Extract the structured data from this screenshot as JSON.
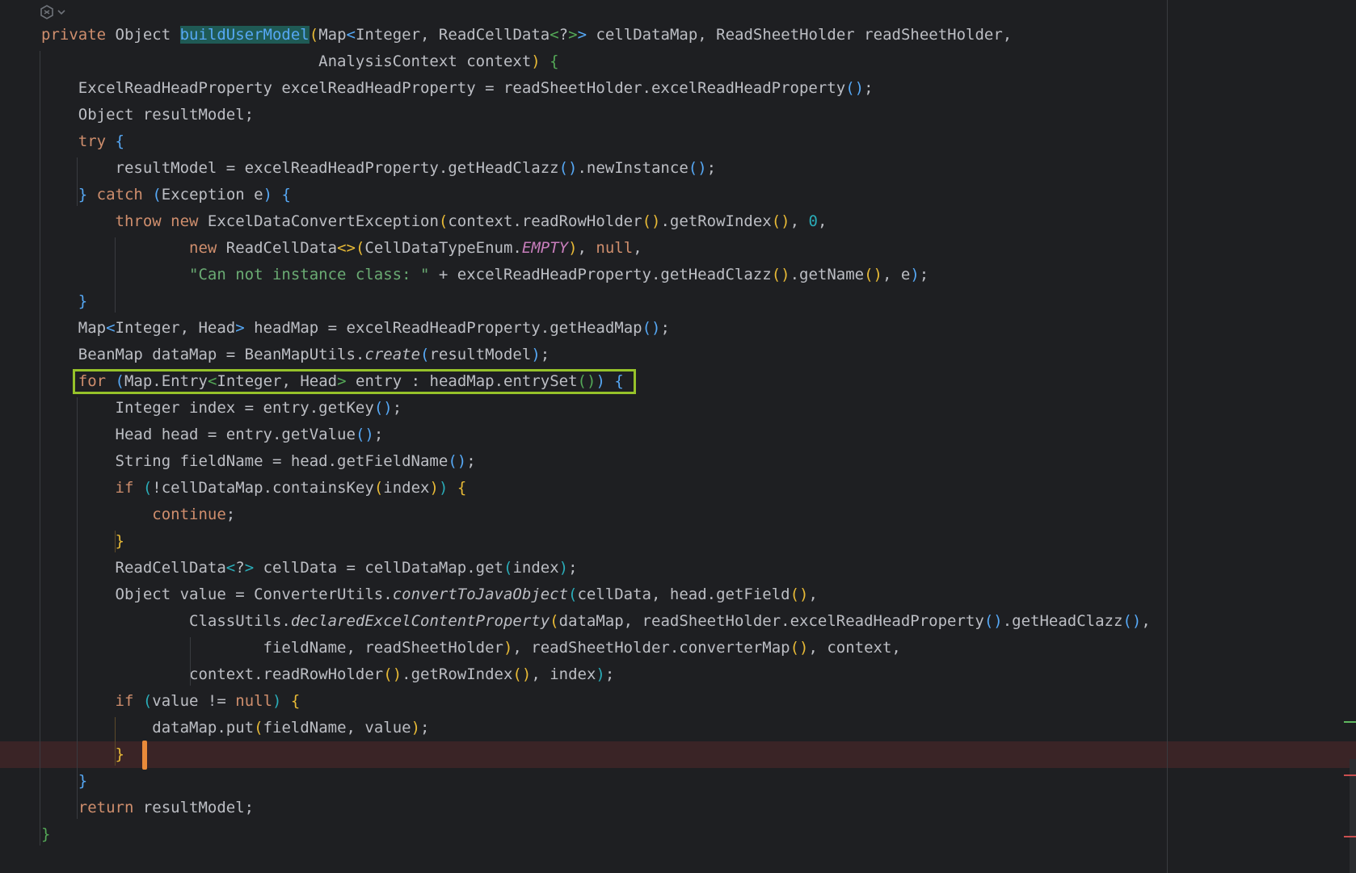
{
  "gutter": {
    "icon": "ai-assistant-icon",
    "chevron": "chevron-down-icon"
  },
  "highlights": {
    "green_box_line": 13,
    "orange_box_line": 27,
    "breakpoint_line": 27
  },
  "code_lines": [
    [
      [
        "kw",
        "private"
      ],
      [
        "p",
        " Object "
      ],
      [
        "hl",
        "buildUserModel"
      ],
      [
        "pn1",
        "("
      ],
      [
        "p",
        "Map"
      ],
      [
        "pn2",
        "<"
      ],
      [
        "p",
        "Integer, ReadCellData"
      ],
      [
        "pn3",
        "<"
      ],
      [
        "p",
        "?"
      ],
      [
        "pn3",
        ">"
      ],
      [
        "pn2",
        ">"
      ],
      [
        "p",
        " cellDataMap, ReadSheetHolder readSheetHolder,"
      ]
    ],
    [
      [
        "p",
        "                              AnalysisContext context"
      ],
      [
        "pn1",
        ")"
      ],
      [
        "p",
        " "
      ],
      [
        "pn3",
        "{"
      ]
    ],
    [
      [
        "p",
        "    ExcelReadHeadProperty excelReadHeadProperty = readSheetHolder.excelReadHeadProperty"
      ],
      [
        "pn2",
        "()"
      ],
      [
        "p",
        ";"
      ]
    ],
    [
      [
        "p",
        "    Object resultModel;"
      ]
    ],
    [
      [
        "kw",
        "    try"
      ],
      [
        "p",
        " "
      ],
      [
        "pn2",
        "{"
      ]
    ],
    [
      [
        "p",
        "        resultModel = excelReadHeadProperty.getHeadClazz"
      ],
      [
        "pn2",
        "()"
      ],
      [
        "p",
        ".newInstance"
      ],
      [
        "pn2",
        "()"
      ],
      [
        "p",
        ";"
      ]
    ],
    [
      [
        "pn2",
        "    }"
      ],
      [
        "p",
        " "
      ],
      [
        "kw",
        "catch"
      ],
      [
        "p",
        " "
      ],
      [
        "pn2",
        "("
      ],
      [
        "p",
        "Exception e"
      ],
      [
        "pn2",
        ")"
      ],
      [
        "p",
        " "
      ],
      [
        "pn2",
        "{"
      ]
    ],
    [
      [
        "kw",
        "        throw new"
      ],
      [
        "p",
        " ExcelDataConvertException"
      ],
      [
        "pn1",
        "("
      ],
      [
        "p",
        "context.readRowHolder"
      ],
      [
        "pn1",
        "()"
      ],
      [
        "p",
        ".getRowIndex"
      ],
      [
        "pn1",
        "()"
      ],
      [
        "p",
        ", "
      ],
      [
        "num",
        "0"
      ],
      [
        "p",
        ","
      ]
    ],
    [
      [
        "kw",
        "                new"
      ],
      [
        "p",
        " ReadCellData"
      ],
      [
        "pn1",
        "<>"
      ],
      [
        "pn1",
        "("
      ],
      [
        "p",
        "CellDataTypeEnum."
      ],
      [
        "cst",
        "EMPTY"
      ],
      [
        "pn1",
        ")"
      ],
      [
        "p",
        ", "
      ],
      [
        "kw",
        "null"
      ],
      [
        "p",
        ","
      ]
    ],
    [
      [
        "str",
        "                \"Can not instance class: \""
      ],
      [
        "p",
        " + excelReadHeadProperty.getHeadClazz"
      ],
      [
        "pn1",
        "()"
      ],
      [
        "p",
        ".getName"
      ],
      [
        "pn1",
        "()"
      ],
      [
        "p",
        ", e"
      ],
      [
        "pn2",
        ")"
      ],
      [
        "p",
        ";"
      ]
    ],
    [
      [
        "pn2",
        "    }"
      ]
    ],
    [
      [
        "p",
        "    Map"
      ],
      [
        "pn2",
        "<"
      ],
      [
        "p",
        "Integer, Head"
      ],
      [
        "pn2",
        ">"
      ],
      [
        "p",
        " headMap = excelReadHeadProperty.getHeadMap"
      ],
      [
        "pn2",
        "()"
      ],
      [
        "p",
        ";"
      ]
    ],
    [
      [
        "p",
        "    BeanMap dataMap = BeanMapUtils."
      ],
      [
        "itl",
        "create"
      ],
      [
        "pn2",
        "("
      ],
      [
        "p",
        "resultModel"
      ],
      [
        "pn2",
        ")"
      ],
      [
        "p",
        ";"
      ]
    ],
    [
      [
        "kw",
        "    for"
      ],
      [
        "p",
        " "
      ],
      [
        "pn2",
        "("
      ],
      [
        "p",
        "Map.Entry"
      ],
      [
        "pn3",
        "<"
      ],
      [
        "p",
        "Integer, Head"
      ],
      [
        "pn3",
        ">"
      ],
      [
        "p",
        " entry : headMap.entrySet"
      ],
      [
        "pn3",
        "()"
      ],
      [
        "pn2",
        ")"
      ],
      [
        "p",
        " "
      ],
      [
        "pn2",
        "{"
      ]
    ],
    [
      [
        "p",
        "        Integer index = entry.getKey"
      ],
      [
        "pn2",
        "()"
      ],
      [
        "p",
        ";"
      ]
    ],
    [
      [
        "p",
        "        Head head = entry.getValue"
      ],
      [
        "pn2",
        "()"
      ],
      [
        "p",
        ";"
      ]
    ],
    [
      [
        "p",
        "        String fieldName = head.getFieldName"
      ],
      [
        "pn2",
        "()"
      ],
      [
        "p",
        ";"
      ]
    ],
    [
      [
        "kw",
        "        if"
      ],
      [
        "p",
        " "
      ],
      [
        "pn4",
        "("
      ],
      [
        "p",
        "!cellDataMap.containsKey"
      ],
      [
        "pn1",
        "("
      ],
      [
        "p",
        "index"
      ],
      [
        "pn1",
        ")"
      ],
      [
        "pn4",
        ")"
      ],
      [
        "p",
        " "
      ],
      [
        "pn1",
        "{"
      ]
    ],
    [
      [
        "kw",
        "            continue"
      ],
      [
        "p",
        ";"
      ]
    ],
    [
      [
        "pn1",
        "        }"
      ]
    ],
    [
      [
        "p",
        "        ReadCellData"
      ],
      [
        "pn4",
        "<"
      ],
      [
        "p",
        "?"
      ],
      [
        "pn4",
        ">"
      ],
      [
        "p",
        " cellData = cellDataMap.get"
      ],
      [
        "pn4",
        "("
      ],
      [
        "p",
        "index"
      ],
      [
        "pn4",
        ")"
      ],
      [
        "p",
        ";"
      ]
    ],
    [
      [
        "p",
        "        Object value = ConverterUtils."
      ],
      [
        "itl",
        "convertToJavaObject"
      ],
      [
        "pn4",
        "("
      ],
      [
        "p",
        "cellData, head.getField"
      ],
      [
        "pn1",
        "()"
      ],
      [
        "p",
        ","
      ]
    ],
    [
      [
        "p",
        "                ClassUtils."
      ],
      [
        "itl",
        "declaredExcelContentProperty"
      ],
      [
        "pn1",
        "("
      ],
      [
        "p",
        "dataMap, readSheetHolder.excelReadHeadProperty"
      ],
      [
        "pn2",
        "()"
      ],
      [
        "p",
        ".getHeadClazz"
      ],
      [
        "pn2",
        "()"
      ],
      [
        "p",
        ","
      ]
    ],
    [
      [
        "p",
        "                        fieldName, readSheetHolder"
      ],
      [
        "pn1",
        ")"
      ],
      [
        "p",
        ", readSheetHolder.converterMap"
      ],
      [
        "pn1",
        "()"
      ],
      [
        "p",
        ", context,"
      ]
    ],
    [
      [
        "p",
        "                context.readRowHolder"
      ],
      [
        "pn1",
        "()"
      ],
      [
        "p",
        ".getRowIndex"
      ],
      [
        "pn1",
        "()"
      ],
      [
        "p",
        ", index"
      ],
      [
        "pn4",
        ")"
      ],
      [
        "p",
        ";"
      ]
    ],
    [
      [
        "kw",
        "        if"
      ],
      [
        "p",
        " "
      ],
      [
        "pn4",
        "("
      ],
      [
        "p",
        "value != "
      ],
      [
        "kw",
        "null"
      ],
      [
        "pn4",
        ")"
      ],
      [
        "p",
        " "
      ],
      [
        "pn1",
        "{"
      ]
    ],
    [
      [
        "p",
        "            dataMap.put"
      ],
      [
        "pn1",
        "("
      ],
      [
        "p",
        "fieldName, value"
      ],
      [
        "pn1",
        ")"
      ],
      [
        "p",
        ";"
      ]
    ],
    [
      [
        "pn1",
        "        }"
      ]
    ],
    [
      [
        "pn2",
        "    }"
      ]
    ],
    [
      [
        "kw",
        "    return"
      ],
      [
        "p",
        " resultModel;"
      ]
    ],
    [
      [
        "pn3",
        "}"
      ]
    ]
  ]
}
